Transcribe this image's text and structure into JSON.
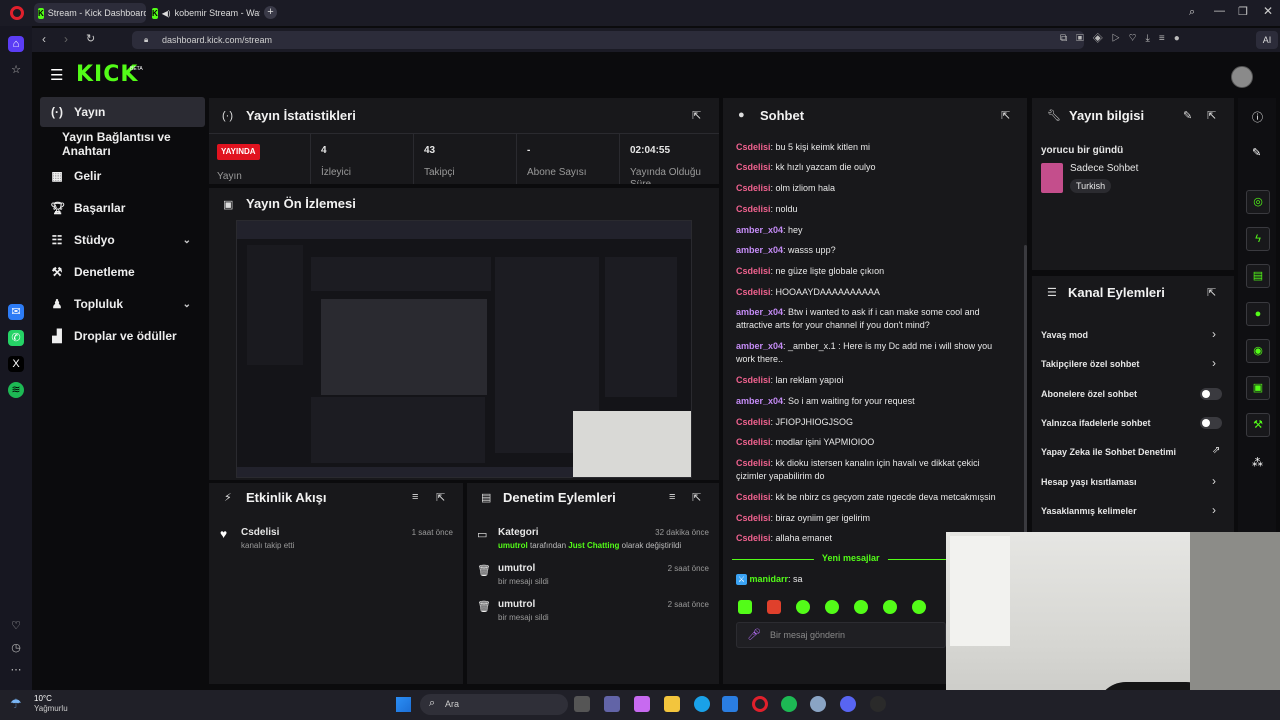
{
  "browser": {
    "tabs": [
      {
        "label": "Stream - Kick Dashboard"
      },
      {
        "label": "kobemir Stream - Wat"
      }
    ],
    "url": "dashboard.kick.com/stream",
    "ai_label": "AI"
  },
  "brand": {
    "logo": "KICK",
    "beta": "BETA",
    "accent": "#53fc18"
  },
  "nav": {
    "items": [
      {
        "label": "Yayın",
        "icon": "live-icon"
      },
      {
        "label": "Yayın Bağlantısı ve Anahtarı",
        "icon": ""
      },
      {
        "label": "Gelir",
        "icon": "income-icon"
      },
      {
        "label": "Başarılar",
        "icon": "trophy-icon"
      },
      {
        "label": "Stüdyo",
        "icon": "studio-icon"
      },
      {
        "label": "Denetleme",
        "icon": "moderation-icon"
      },
      {
        "label": "Topluluk",
        "icon": "community-icon"
      },
      {
        "label": "Droplar ve ödüller",
        "icon": "drops-icon"
      }
    ]
  },
  "stats": {
    "title": "Yayın İstatistikleri",
    "live_badge": "YAYINDA",
    "live_label": "Yayın",
    "cells": [
      {
        "value": "4",
        "label": "İzleyici"
      },
      {
        "value": "43",
        "label": "Takipçi"
      },
      {
        "value": "-",
        "label": "Abone Sayısı"
      },
      {
        "value": "02:04:55",
        "label": "Yayında Olduğu Süre"
      }
    ]
  },
  "preview": {
    "title": "Yayın Ön İzlemesi"
  },
  "activity": {
    "title": "Etkinlik Akışı",
    "items": [
      {
        "user": "Csdelisi",
        "text": "kanalı takip etti",
        "time": "1 saat önce"
      }
    ]
  },
  "modlog": {
    "title": "Denetim Eylemleri",
    "items": [
      {
        "title": "Kategori",
        "time": "32 dakika önce",
        "user": "umutrol",
        "mid": "tarafından",
        "hl": "Just Chatting",
        "tail": "olarak değiştirildi"
      },
      {
        "title": "umutrol",
        "time": "2 saat önce",
        "text": "bir mesajı sildi"
      },
      {
        "title": "umutrol",
        "time": "2 saat önce",
        "text": "bir mesajı sildi"
      }
    ]
  },
  "chat": {
    "title": "Sohbet",
    "messages": [
      {
        "user": "Csdelisi",
        "color": "#f0628f",
        "text": ": bu 5 kişi keimk kitlen mi"
      },
      {
        "user": "Csdelisi",
        "color": "#f0628f",
        "text": ": kk hızlı yazcam die oulyo"
      },
      {
        "user": "Csdelisi",
        "color": "#f0628f",
        "text": ": olm izliom hala"
      },
      {
        "user": "Csdelisi",
        "color": "#f0628f",
        "text": ": noldu"
      },
      {
        "user": "amber_x04",
        "color": "#c58cf6",
        "text": ": hey"
      },
      {
        "user": "amber_x04",
        "color": "#c58cf6",
        "text": ": wasss upp?"
      },
      {
        "user": "Csdelisi",
        "color": "#f0628f",
        "text": ": ne güze lişte globale çıkıon"
      },
      {
        "user": "Csdelisi",
        "color": "#f0628f",
        "text": ": HOOAAYDAAAAAAAAAA"
      },
      {
        "user": "amber_x04",
        "color": "#c58cf6",
        "text": ": Btw i wanted to ask if i can make some cool and attractive arts for your channel if you don't mind?"
      },
      {
        "user": "amber_x04",
        "color": "#c58cf6",
        "text": ": _amber_x.1 : Here is my Dc add me i will show you work there.."
      },
      {
        "user": "Csdelisi",
        "color": "#f0628f",
        "text": ": lan reklam yapıoi"
      },
      {
        "user": "amber_x04",
        "color": "#c58cf6",
        "text": ": So i am waiting for your request"
      },
      {
        "user": "Csdelisi",
        "color": "#f0628f",
        "text": ": JFIOPJHIOGJSOG"
      },
      {
        "user": "Csdelisi",
        "color": "#f0628f",
        "text": ": modlar işini YAPMIOIOO"
      },
      {
        "user": "Csdelisi",
        "color": "#f0628f",
        "text": ": kk dioku istersen kanalın için havalı ve dikkat çekici çizimler yapabilirim do"
      },
      {
        "user": "Csdelisi",
        "color": "#f0628f",
        "text": ": kk be nbirz cs geçyom zate ngecde deva metcakmışsin"
      },
      {
        "user": "Csdelisi",
        "color": "#f0628f",
        "text": ": biraz oyniim ger igelirim"
      },
      {
        "user": "Csdelisi",
        "color": "#f0628f",
        "text": ": allaha emanet"
      }
    ],
    "new_messages": "Yeni mesajlar",
    "last": {
      "user": "manidarr",
      "text": ": sa"
    },
    "input_placeholder": "Bir mesaj gönderin"
  },
  "info": {
    "title": "Yayın bilgisi",
    "stream_title": "yorucu bir gündü",
    "category": "Sadece Sohbet",
    "language": "Turkish"
  },
  "channel_actions": {
    "title": "Kanal Eylemleri",
    "items": [
      {
        "label": "Yavaş mod",
        "kind": "chevron"
      },
      {
        "label": "Takipçilere özel sohbet",
        "kind": "chevron"
      },
      {
        "label": "Abonelere özel sohbet",
        "kind": "toggle"
      },
      {
        "label": "Yalnızca ifadelerle sohbet",
        "kind": "toggle"
      },
      {
        "label": "Yapay Zeka ile Sohbet Denetimi",
        "kind": "external"
      },
      {
        "label": "Hesap yaşı kısıtlaması",
        "kind": "chevron"
      },
      {
        "label": "Yasaklanmış kelimeler",
        "kind": "chevron"
      }
    ]
  },
  "taskbar": {
    "weather_temp": "10°C",
    "weather_desc": "Yağmurlu",
    "search": "Ara"
  }
}
